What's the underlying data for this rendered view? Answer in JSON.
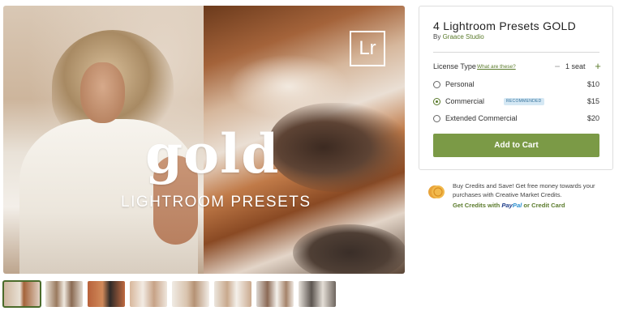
{
  "hero": {
    "badge": "Lr",
    "title": "gold",
    "subtitle": "LIGHTROOM PRESETS"
  },
  "thumbnails": [
    {
      "selected": true
    },
    {
      "selected": false
    },
    {
      "selected": false
    },
    {
      "selected": false
    },
    {
      "selected": false
    },
    {
      "selected": false
    },
    {
      "selected": false
    },
    {
      "selected": false
    }
  ],
  "product": {
    "title": "4 Lightroom Presets GOLD",
    "by_prefix": "By",
    "shop_name": "Graace Studio"
  },
  "license": {
    "label": "License Type",
    "help_link": "What are these?",
    "seat_minus": "−",
    "seat_count": "1 seat",
    "seat_plus": "+",
    "options": [
      {
        "label": "Personal",
        "price": "$10",
        "selected": false,
        "badge": ""
      },
      {
        "label": "Commercial",
        "price": "$15",
        "selected": true,
        "badge": "RECOMMENDED"
      },
      {
        "label": "Extended Commercial",
        "price": "$20",
        "selected": false,
        "badge": ""
      }
    ]
  },
  "cart": {
    "add_label": "Add to Cart"
  },
  "credits": {
    "text": "Buy Credits and Save! Get free money towards your purchases with Creative Market Credits.",
    "get_credits_with": "Get Credits with",
    "paypal_pay": "Pay",
    "paypal_pal": "Pal",
    "or_label": "or Credit Card"
  },
  "colors": {
    "accent_green": "#7b9a46",
    "link_green": "#5a7a2b",
    "badge_blue": "#d5e8f4"
  }
}
